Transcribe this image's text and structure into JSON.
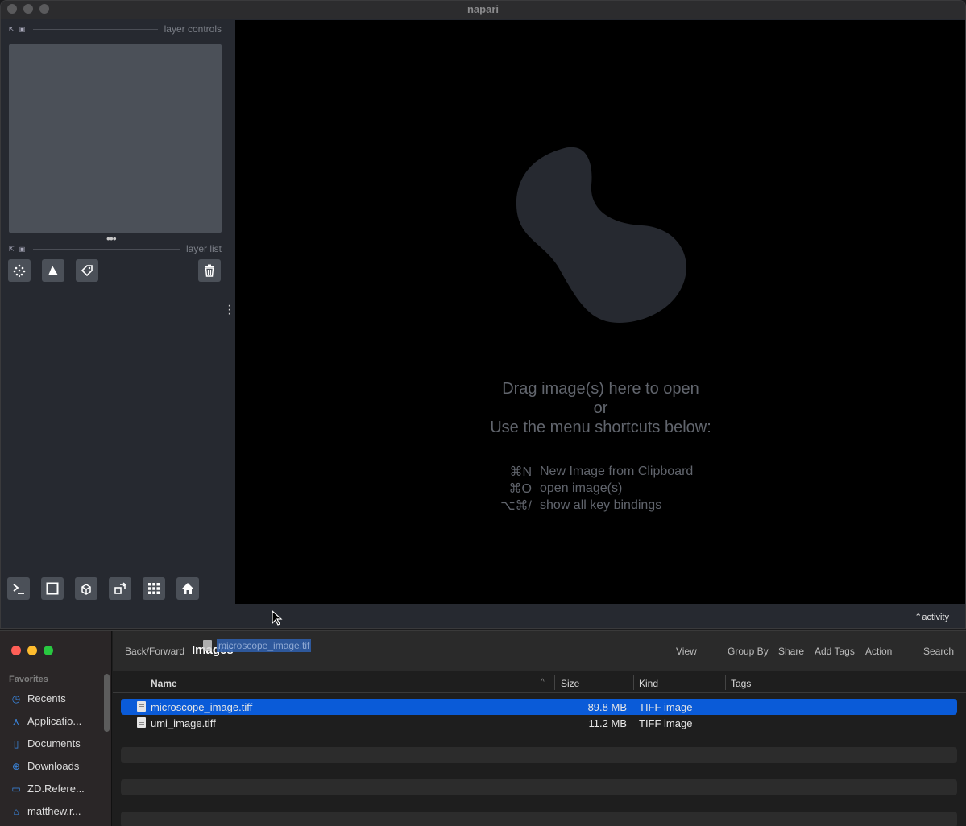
{
  "napari": {
    "title": "napari",
    "layer_controls_label": "layer controls",
    "layer_list_label": "layer list",
    "welcome_lines": [
      "Drag image(s) here to open",
      "or",
      "Use the menu shortcuts below:"
    ],
    "shortcuts": [
      {
        "key": "⌘N",
        "desc": "New Image from Clipboard"
      },
      {
        "key": "⌘O",
        "desc": "open image(s)"
      },
      {
        "key": "⌥⌘/",
        "desc": "show all key bindings"
      }
    ],
    "activity_label": "activity",
    "layer_tools": [
      "new-points-icon",
      "new-shapes-icon",
      "new-labels-icon",
      "delete-layer-icon"
    ],
    "bottom_tools": [
      "console-icon",
      "2d-3d-toggle-icon",
      "roll-dims-icon",
      "transpose-icon",
      "grid-icon",
      "home-icon"
    ]
  },
  "finder": {
    "folder_title": "Images",
    "toolbar": {
      "back_forward": "Back/Forward",
      "view": "View",
      "group_by": "Group By",
      "share": "Share",
      "add_tags": "Add Tags",
      "action": "Action",
      "search": "Search"
    },
    "drag_file_name": "microscope_image.tif",
    "favorites_label": "Favorites",
    "sidebar": [
      {
        "label": "Recents",
        "icon": "clock-icon"
      },
      {
        "label": "Applicatio...",
        "icon": "applications-icon"
      },
      {
        "label": "Documents",
        "icon": "document-icon"
      },
      {
        "label": "Downloads",
        "icon": "download-icon"
      },
      {
        "label": "ZD.Refere...",
        "icon": "folder-icon"
      },
      {
        "label": "matthew.r...",
        "icon": "home-icon"
      }
    ],
    "columns": {
      "name": "Name",
      "size": "Size",
      "kind": "Kind",
      "tags": "Tags"
    },
    "files": [
      {
        "name": "microscope_image.tiff",
        "size": "89.8 MB",
        "kind": "TIFF image",
        "selected": true
      },
      {
        "name": "umi_image.tiff",
        "size": "11.2 MB",
        "kind": "TIFF image",
        "selected": false
      }
    ],
    "colors": {
      "selection": "#0a5bd8",
      "accent": "#3b8be8"
    }
  }
}
